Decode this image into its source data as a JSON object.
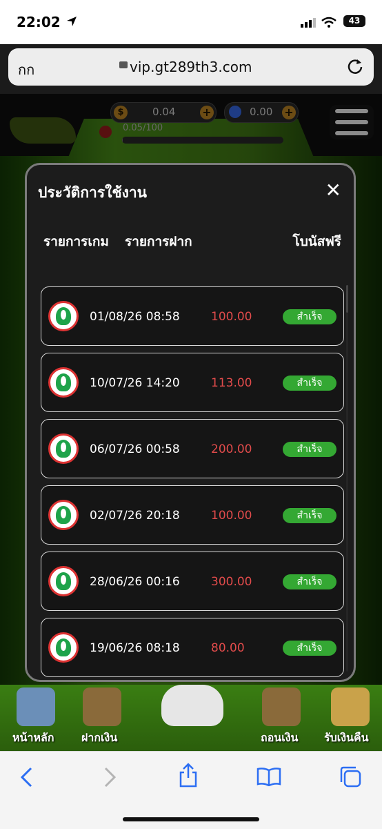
{
  "status_bar": {
    "time": "22:02",
    "battery": "43"
  },
  "browser": {
    "text_size_label": "กก",
    "url": "vip.gt289th3.com"
  },
  "game_header": {
    "coin_balance": "0.04",
    "gem_balance": "0.00",
    "progress_label": "0.05/100",
    "progress_fraction": 0.0005
  },
  "modal": {
    "title": "ประวัติการใช้งาน",
    "tabs": [
      "รายการเกม",
      "รายการฝาก",
      "โบนัสฟรี"
    ],
    "rows": [
      {
        "date": "01/08/26 08:58",
        "amount": "100.00",
        "status": "สำเร็จ"
      },
      {
        "date": "10/07/26 14:20",
        "amount": "113.00",
        "status": "สำเร็จ"
      },
      {
        "date": "06/07/26 00:58",
        "amount": "200.00",
        "status": "สำเร็จ"
      },
      {
        "date": "02/07/26 20:18",
        "amount": "100.00",
        "status": "สำเร็จ"
      },
      {
        "date": "28/06/26 00:16",
        "amount": "300.00",
        "status": "สำเร็จ"
      },
      {
        "date": "19/06/26 08:18",
        "amount": "80.00",
        "status": "สำเร็จ"
      }
    ]
  },
  "bottom_nav": {
    "items": [
      "หน้าหลัก",
      "ฝากเงิน",
      "ถอนเงิน",
      "รับเงินคืน"
    ]
  },
  "colors": {
    "amount": "#e14b4b",
    "status_badge": "#34a833",
    "bank_ring": "#dd3333",
    "bank_green": "#1ea34a",
    "safari_blue": "#2c6ef3"
  },
  "icons": [
    "location-arrow-icon",
    "signal-icon",
    "wifi-icon",
    "lock-icon",
    "reload-icon",
    "coin-icon",
    "gem-icon",
    "plus-icon",
    "menu-icon",
    "close-icon",
    "bank-logo-icon",
    "back-icon",
    "forward-icon",
    "share-icon",
    "bookmarks-icon",
    "tabs-icon"
  ]
}
